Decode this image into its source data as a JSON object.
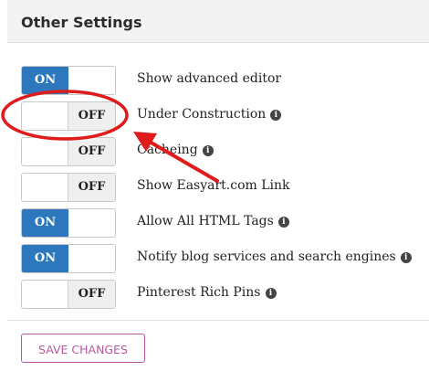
{
  "header": {
    "title": "Other Settings"
  },
  "settings": [
    {
      "state": "ON",
      "label": "Show advanced editor",
      "info": false
    },
    {
      "state": "OFF",
      "label": "Under Construction",
      "info": true
    },
    {
      "state": "OFF",
      "label": "Cacheing",
      "info": true
    },
    {
      "state": "OFF",
      "label": "Show Easyart.com Link",
      "info": false
    },
    {
      "state": "ON",
      "label": "Allow All HTML Tags",
      "info": true
    },
    {
      "state": "ON",
      "label": "Notify blog services and search engines",
      "info": true
    },
    {
      "state": "OFF",
      "label": "Pinterest Rich Pins",
      "info": true
    }
  ],
  "info_glyph": "i",
  "actions": {
    "save_label": "SAVE CHANGES"
  },
  "colors": {
    "on_bg": "#2d78bd",
    "save_border": "#b9589f",
    "annotation": "#e01b1b"
  },
  "annotation": {
    "highlighted_setting": "Under Construction"
  }
}
